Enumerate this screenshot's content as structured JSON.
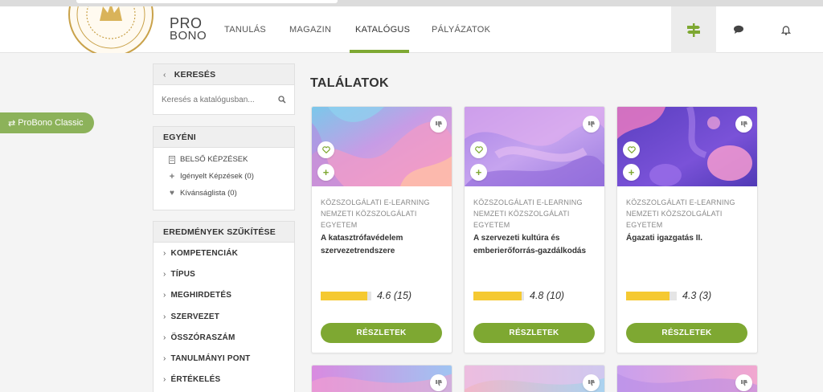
{
  "brand": {
    "line1": "PRO",
    "line2": "BONO"
  },
  "seal_text": "NEMZETI KÖZSZOLGÁLATI EGYETEM",
  "nav": {
    "items": [
      "TANULÁS",
      "MAGAZIN",
      "KATALÓGUS",
      "PÁLYÁZATOK"
    ],
    "active": "KATALÓGUS"
  },
  "accent_color": "#7ea832",
  "classic_button": "ProBono Classic",
  "search": {
    "header": "KERESÉS",
    "placeholder": "Keresés a katalógusban..."
  },
  "personal": {
    "header": "EGYÉNI",
    "items": [
      {
        "label": "BELSŐ KÉPZÉSEK",
        "icon": "building-icon"
      },
      {
        "label": "Igényelt Képzések (0)",
        "icon": "plus-icon"
      },
      {
        "label": "Kívánságlista (0)",
        "icon": "heart-icon"
      }
    ]
  },
  "facets": {
    "header": "EREDMÉNYEK SZŰKÍTÉSE",
    "items": [
      "KOMPETENCIÁK",
      "TÍPUS",
      "MEGHIRDETÉS",
      "SZERVEZET",
      "ÖSSZÓRASZÁM",
      "TANULMÁNYI PONT",
      "ÉRTÉKELÉS"
    ]
  },
  "results_title": "TALÁLATOK",
  "cards": [
    {
      "category": "KÖZSZOLGÁLATI E-LEARNING",
      "institution": "NEMZETI KÖZSZOLGÁLATI EGYETEM",
      "title": "A katasztrófavédelem szervezetrendszere",
      "rating": 4.6,
      "rating_text": "4.6 (15)",
      "button": "RÉSZLETEK",
      "image": "pink-blue-wave"
    },
    {
      "category": "KÖZSZOLGÁLATI E-LEARNING",
      "institution": "NEMZETI KÖZSZOLGÁLATI EGYETEM",
      "title": "A szervezeti kultúra és emberierőforrás-gazdálkodás",
      "rating": 4.8,
      "rating_text": "4.8 (10)",
      "button": "RÉSZLETEK",
      "image": "purple-wave"
    },
    {
      "category": "KÖZSZOLGÁLATI E-LEARNING",
      "institution": "NEMZETI KÖZSZOLGÁLATI EGYETEM",
      "title": "Ágazati igazgatás II.",
      "rating": 4.3,
      "rating_text": "4.3 (3)",
      "button": "RÉSZLETEK",
      "image": "violet-blob"
    }
  ]
}
